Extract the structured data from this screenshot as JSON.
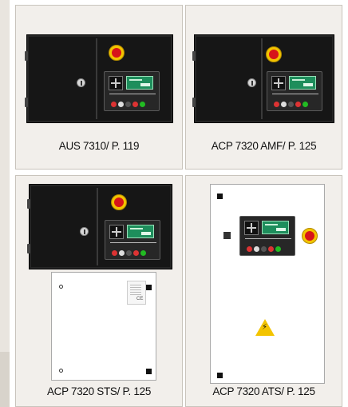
{
  "products": [
    {
      "caption": "AUS 7310/ P. 119"
    },
    {
      "caption": "ACP 7320 AMF/ P. 125"
    },
    {
      "caption": "ACP 7320 STS/ P. 125"
    },
    {
      "caption": "ACP 7320 ATS/ P. 125"
    }
  ],
  "label_text": "CE",
  "colors": {
    "card_background": "#f2efeb",
    "cabinet_black": "#161616",
    "emergency_stop_red": "#d7141a",
    "emergency_stop_yellow": "#f3c400",
    "lcd_green": "#1e8e5c"
  }
}
